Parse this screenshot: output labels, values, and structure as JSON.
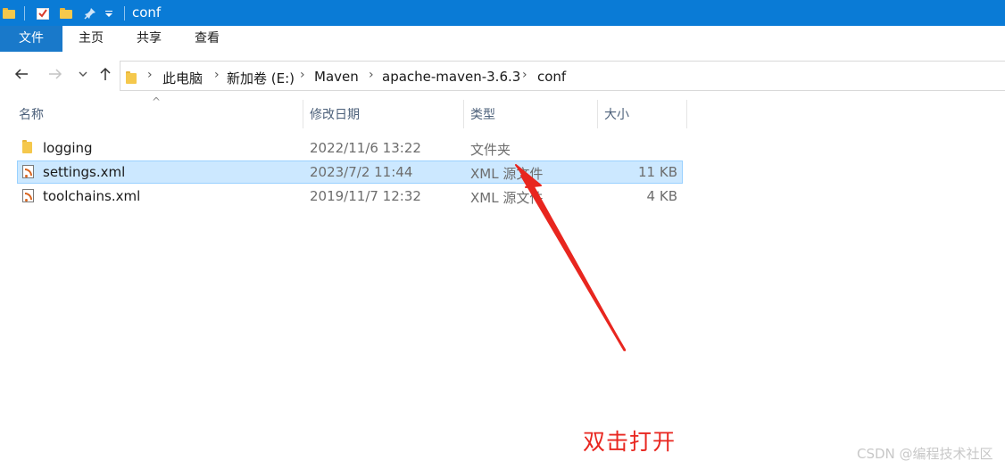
{
  "window": {
    "title": "conf"
  },
  "ribbon": {
    "tabs": [
      "文件",
      "主页",
      "共享",
      "查看"
    ]
  },
  "address": {
    "crumbs": [
      "此电脑",
      "新加卷 (E:)",
      "Maven",
      "apache-maven-3.6.3",
      "conf"
    ]
  },
  "columns": {
    "name": "名称",
    "date": "修改日期",
    "type": "类型",
    "size": "大小"
  },
  "files": [
    {
      "name": "logging",
      "date": "2022/11/6 13:22",
      "type": "文件夹",
      "size": "",
      "icon": "folder-icon",
      "selected": false
    },
    {
      "name": "settings.xml",
      "date": "2023/7/2 11:44",
      "type": "XML 源文件",
      "size": "11 KB",
      "icon": "xml-file-icon",
      "selected": true
    },
    {
      "name": "toolchains.xml",
      "date": "2019/11/7 12:32",
      "type": "XML 源文件",
      "size": "4 KB",
      "icon": "xml-file-icon",
      "selected": false
    }
  ],
  "annotation": {
    "text": "双击打开",
    "color": "#e8261f"
  },
  "watermark": "CSDN @编程技术社区",
  "colors": {
    "titlebar": "#0a7bd6",
    "selection": "#cce8ff",
    "selection_border": "#99d1ff"
  }
}
